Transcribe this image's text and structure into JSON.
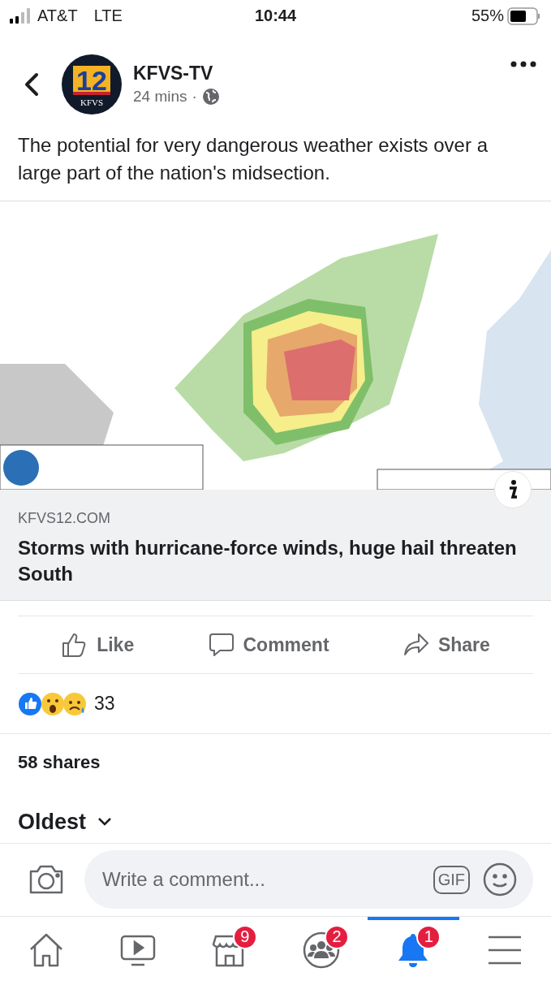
{
  "status_bar": {
    "carrier": "AT&T",
    "network": "LTE",
    "time": "10:44",
    "battery": "55%"
  },
  "post": {
    "avatar": {
      "number": "12",
      "caption": "KFVS"
    },
    "author": "KFVS-TV",
    "time": "24 mins",
    "separator": "·",
    "text": "The potential for very dangerous weather exists over a large part of the nation's midsection.",
    "link": {
      "domain": "KFVS12.COM",
      "title": "Storms with hurricane-force winds, huge hail threaten South"
    },
    "actions": [
      {
        "kind": "like",
        "label": "Like"
      },
      {
        "kind": "comment",
        "label": "Comment"
      },
      {
        "kind": "share",
        "label": "Share"
      }
    ],
    "reactions": {
      "count": "33"
    },
    "shares": "58 shares",
    "sort": "Oldest"
  },
  "comment_bar": {
    "placeholder": "Write a comment...",
    "gif": "GIF"
  },
  "nav": [
    {
      "kind": "home",
      "selected": false
    },
    {
      "kind": "video",
      "selected": false
    },
    {
      "kind": "shop",
      "selected": false,
      "badge": "9"
    },
    {
      "kind": "groups",
      "selected": false,
      "badge": "2"
    },
    {
      "kind": "bell",
      "selected": true,
      "badge": "1"
    },
    {
      "kind": "menu",
      "selected": false
    }
  ]
}
